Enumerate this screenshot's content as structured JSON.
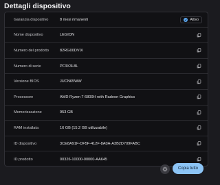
{
  "header": {
    "title": "Dettagli dispositivo"
  },
  "rows": [
    {
      "label": "Garanzia dispositivo",
      "value": "8 mesi rimanenti",
      "badge": "Attivo"
    },
    {
      "label": "Nome dispositivo",
      "value": "LEGION"
    },
    {
      "label": "Numero del prodotto",
      "value": "82RG00DVIX"
    },
    {
      "label": "Numero di serie",
      "value": "PF3X3L8L"
    },
    {
      "label": "Versione BIOS",
      "value": "JUCN65WW"
    },
    {
      "label": "Processore",
      "value": "AMD Ryzen 7 6800H with Radeon Graphics"
    },
    {
      "label": "Memorizzazione",
      "value": "953 GB"
    },
    {
      "label": "RAM installata",
      "value": "16 GB (15.2 GB utilizzabile)"
    },
    {
      "label": "ID dispositivo",
      "value": "3CE8A91F-DF5F-412F-8A0A-A3B2D709FABC"
    },
    {
      "label": "ID prodotto",
      "value": "00326-10000-00000-AA645"
    }
  ],
  "footer": {
    "copy_all_label": "Copia tutto"
  },
  "colors": {
    "accent": "#8cc4f5",
    "badge_dot": "#5da8f0"
  },
  "icons": {
    "row_action": "copy-icon",
    "badge": "check-icon",
    "footer_round": "gear-icon"
  }
}
